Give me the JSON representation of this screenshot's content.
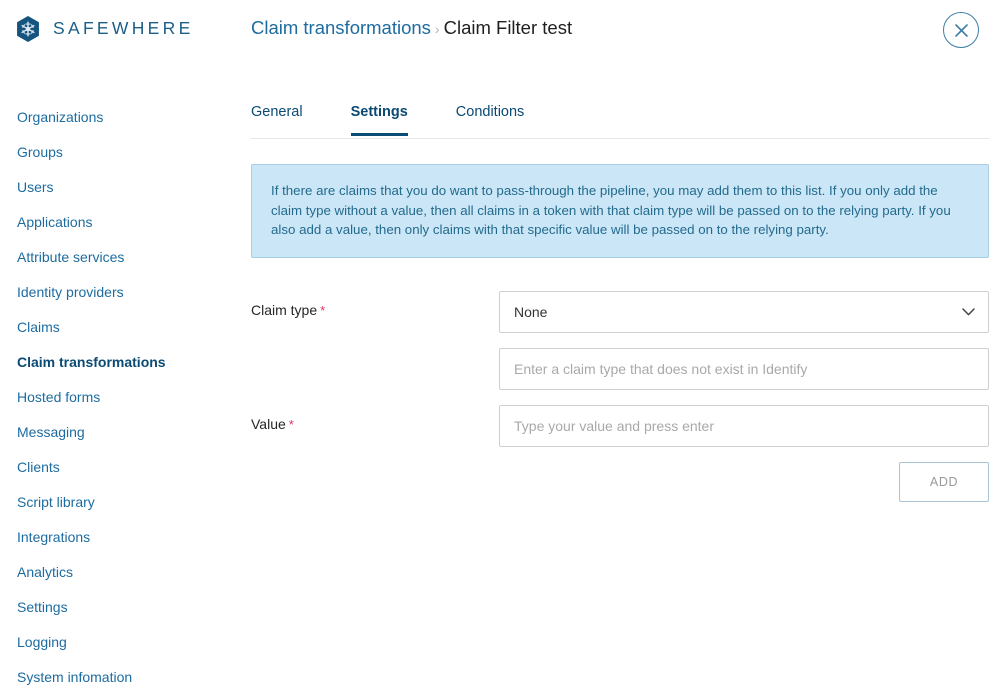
{
  "brand": {
    "name": "SAFEWHERE",
    "logo_icon": "snowflake-hex-icon",
    "logo_color": "#1d5f87"
  },
  "header": {
    "breadcrumb": {
      "parent": "Claim transformations",
      "separator": "›",
      "current": "Claim Filter test"
    },
    "close_icon": "close-icon"
  },
  "sidebar": {
    "active_index": 7,
    "items": [
      {
        "label": "Organizations"
      },
      {
        "label": "Groups"
      },
      {
        "label": "Users"
      },
      {
        "label": "Applications"
      },
      {
        "label": "Attribute services"
      },
      {
        "label": "Identity providers"
      },
      {
        "label": "Claims"
      },
      {
        "label": "Claim transformations"
      },
      {
        "label": "Hosted forms"
      },
      {
        "label": "Messaging"
      },
      {
        "label": "Clients"
      },
      {
        "label": "Script library"
      },
      {
        "label": "Integrations"
      },
      {
        "label": "Analytics"
      },
      {
        "label": "Settings"
      },
      {
        "label": "Logging"
      },
      {
        "label": "System infomation"
      }
    ]
  },
  "main": {
    "tabs": [
      {
        "label": "General",
        "active": false
      },
      {
        "label": "Settings",
        "active": true
      },
      {
        "label": "Conditions",
        "active": false
      }
    ],
    "info_banner": {
      "text": "If there are claims that you do want to pass-through the pipeline, you may add them to this list. If you only add the claim type without a value, then all claims in a token with that claim type will be passed on to the relying party. If you also add a value, then only claims with that specific value will be passed on to the relying party.",
      "background": "#cbe7f7",
      "border": "#a6cfe6",
      "text_color": "#236a8c"
    },
    "form": {
      "claim_type": {
        "label": "Claim type",
        "required_marker": "*",
        "select_value": "None",
        "select_icon": "chevron-down-icon",
        "custom_input_value": "",
        "custom_input_placeholder": "Enter a claim type that does not exist in Identify"
      },
      "value": {
        "label": "Value",
        "required_marker": "*",
        "input_value": "",
        "input_placeholder": "Type your value and press enter"
      },
      "add_button": {
        "label": "ADD",
        "border_color": "#a8c4d4",
        "text_color": "#9a9a9a"
      }
    }
  },
  "colors": {
    "link_blue": "#1d6ca0",
    "active_navy": "#0a4a73",
    "required_red": "#d9365e"
  }
}
